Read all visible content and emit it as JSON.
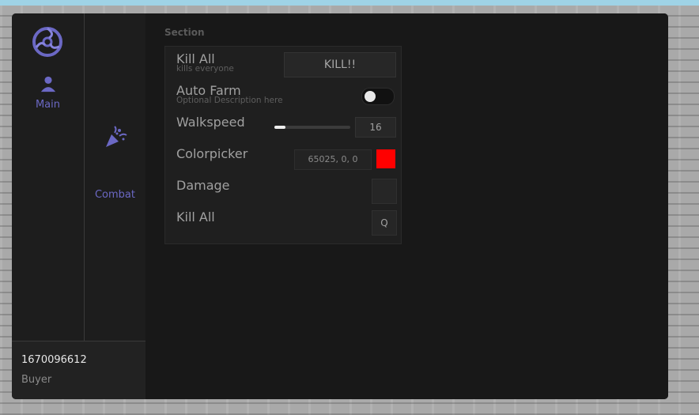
{
  "sidebar": {
    "tabs": [
      {
        "label": "Main",
        "icon": "user-icon"
      },
      {
        "label": "Combat",
        "icon": "confetti-icon"
      }
    ],
    "user": {
      "id": "1670096612",
      "role": "Buyer"
    }
  },
  "section": {
    "title": "Section",
    "rows": [
      {
        "title": "Kill All",
        "description": "kills everyone",
        "button_label": "KILL!!"
      },
      {
        "title": "Auto Farm",
        "description": "Optional Description here",
        "toggle_on": false
      },
      {
        "title": "Walkspeed",
        "value": "16",
        "slider_fraction": 0.15
      },
      {
        "title": "Colorpicker",
        "color_text": "65025, 0, 0",
        "color": "#ff0000"
      },
      {
        "title": "Damage"
      },
      {
        "title": "Kill All",
        "key": "Q"
      }
    ]
  },
  "colors": {
    "accent": "#6b68c4",
    "background": "#181818",
    "panel": "#1f1f1f"
  }
}
